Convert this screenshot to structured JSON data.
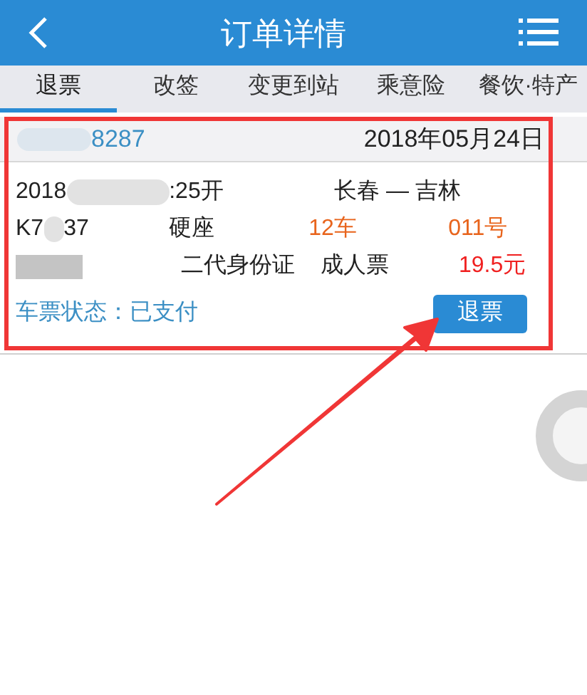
{
  "header": {
    "title": "订单详情"
  },
  "tabs": [
    {
      "label": "退票",
      "selected": true
    },
    {
      "label": "改签",
      "selected": false
    },
    {
      "label": "变更到站",
      "selected": false
    },
    {
      "label": "乘意险",
      "selected": false
    },
    {
      "label": "餐饮·特产",
      "selected": false
    }
  ],
  "order": {
    "number_tail": "8287",
    "date": "2018年05月24日"
  },
  "ticket": {
    "departure_start": "2018",
    "departure_end": ":25开",
    "route": "长春 — 吉林",
    "train_start": "K7",
    "train_end": "37",
    "seat_class": "硬座",
    "car": "12车",
    "seat": "011号",
    "id_type": "二代身份证",
    "ticket_type": "成人票",
    "price": "19.5元",
    "status": "车票状态：已支付",
    "refund_button": "退票"
  }
}
